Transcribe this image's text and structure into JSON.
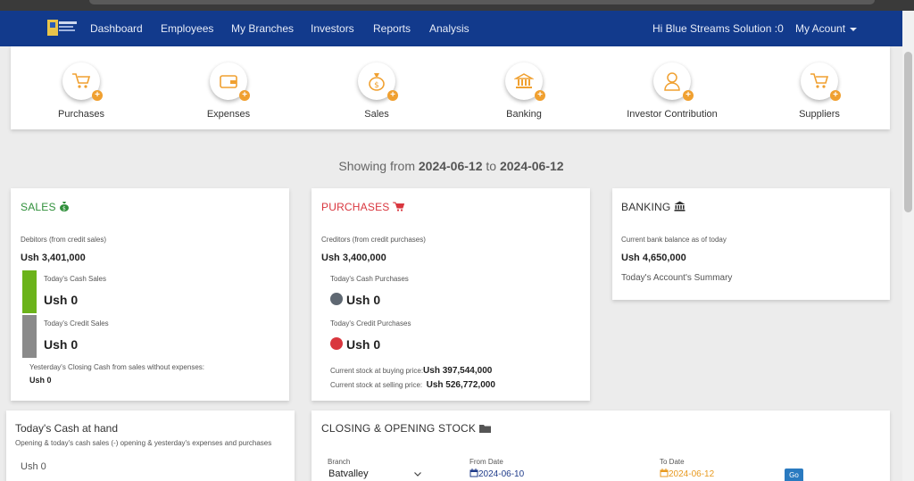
{
  "nav": {
    "items": [
      "Dashboard",
      "Employees",
      "My Branches",
      "Investors",
      "Reports",
      "Analysis"
    ],
    "greeting": "Hi Blue Streams Solution :0",
    "account": "My Acount"
  },
  "quick_actions": [
    {
      "label": "Purchases",
      "icon": "cart-icon"
    },
    {
      "label": "Expenses",
      "icon": "wallet-icon"
    },
    {
      "label": "Sales",
      "icon": "money-bag-icon"
    },
    {
      "label": "Banking",
      "icon": "bank-icon"
    },
    {
      "label": "Investor Contribution",
      "icon": "user-icon"
    },
    {
      "label": "Suppliers",
      "icon": "cart-icon"
    }
  ],
  "showing": {
    "prefix": "Showing from",
    "from": "2024-06-12",
    "mid": "to",
    "to": "2024-06-12"
  },
  "sales": {
    "title": "SALES",
    "debitors_label": "Debitors (from credit sales)",
    "debitors_value": "Ush 3,401,000",
    "cash_label": "Today's Cash Sales",
    "cash_value": "Ush 0",
    "credit_label": "Today's Credit Sales",
    "credit_value": "Ush 0",
    "closing_label": "Yesterday's Closing Cash from sales without expenses:",
    "closing_value": "Ush 0"
  },
  "purchases": {
    "title": "PURCHASES",
    "creditors_label": "Creditors (from credit purchases)",
    "creditors_value": "Ush 3,400,000",
    "cash_label": "Today's Cash Purchases",
    "cash_value": "Ush 0",
    "credit_label": "Today's Credit Purchases",
    "credit_value": "Ush 0",
    "stock_buy_label": "Current stock at buying price:",
    "stock_buy_value": "Ush 397,544,000",
    "stock_sell_label": "Current stock at selling price:",
    "stock_sell_value": "Ush 526,772,000"
  },
  "banking": {
    "title": "BANKING",
    "balance_label": "Current bank balance as of today",
    "balance_value": "Ush 4,650,000",
    "summary_link": "Today's Account's Summary"
  },
  "cash_at_hand": {
    "title": "Today's Cash at hand",
    "subtitle": "Opening & today's cash sales (-) opening & yesterday's expenses and purchases",
    "value": "Ush 0"
  },
  "stock": {
    "title": "CLOSING & OPENING STOCK",
    "branch_label": "Branch",
    "branch_value": "Batvalley",
    "from_label": "From Date",
    "from_value": "2024-06-10",
    "to_label": "To Date",
    "to_value": "2024-06-12",
    "go_label": "Go"
  },
  "colors": {
    "navbar": "#123a8c",
    "sales": "#2f8f3a",
    "purchases": "#d9363e",
    "accent_orange": "#f0a030",
    "bar_green": "#6bb31a",
    "bar_grey": "#8a8a8a",
    "dot_grey": "#5f6872",
    "dot_red": "#d9363e"
  }
}
